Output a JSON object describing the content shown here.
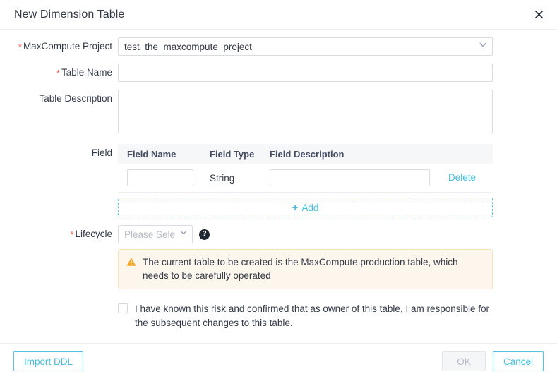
{
  "dialog": {
    "title": "New Dimension Table",
    "close_icon": "close-icon"
  },
  "form": {
    "maxcompute_project": {
      "label": "MaxCompute Project",
      "required": true,
      "value": "test_the_maxcompute_project",
      "chevron": "⌄"
    },
    "table_name": {
      "label": "Table Name",
      "required": true,
      "value": "",
      "placeholder": ""
    },
    "table_description": {
      "label": "Table Description",
      "required": false,
      "value": "",
      "placeholder": ""
    },
    "field": {
      "label": "Field",
      "columns": [
        "Field Name",
        "Field Type",
        "Field Description"
      ],
      "rows": [
        {
          "field_name": "",
          "field_type": "String",
          "field_description": "",
          "delete_label": "Delete"
        }
      ],
      "add_label": "Add",
      "add_plus": "+"
    },
    "lifecycle": {
      "label": "Lifecycle",
      "required": true,
      "selected": "Please Select",
      "chevron": "⌄",
      "help_icon": "?"
    }
  },
  "warning": {
    "icon": "warning-triangle-icon",
    "text": "The current table to be created is the MaxCompute production table, which needs to be carefully operated"
  },
  "risk_acknowledgement": {
    "checked": false,
    "text": "I have known this risk and confirmed that as owner of this table, I am responsible for the subsequent changes to this table."
  },
  "footer": {
    "import_ddl_label": "Import DDL",
    "ok_label": "OK",
    "ok_disabled": true,
    "cancel_label": "Cancel"
  },
  "colors": {
    "accent": "#46BDE0",
    "required_star": "#f5564d",
    "warning_bg": "#FDF6EC",
    "warning_border": "#F7E2C0",
    "warning_icon": "#F5A623",
    "text": "#333a48"
  }
}
